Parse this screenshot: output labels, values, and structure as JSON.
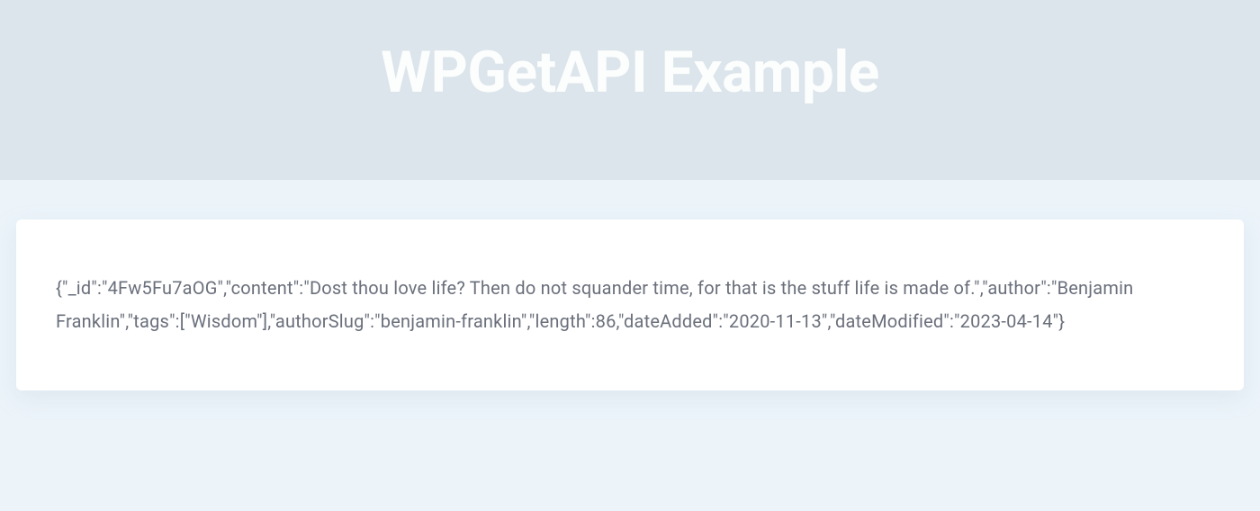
{
  "header": {
    "title": "WPGetAPI Example"
  },
  "content": {
    "json_text": "{\"_id\":\"4Fw5Fu7aOG\",\"content\":\"Dost thou love life? Then do not squander time, for that is the stuff life is made of.\",\"author\":\"Benjamin Franklin\",\"tags\":[\"Wisdom\"],\"authorSlug\":\"benjamin-franklin\",\"length\":86,\"dateAdded\":\"2020-11-13\",\"dateModified\":\"2023-04-14\"}"
  }
}
